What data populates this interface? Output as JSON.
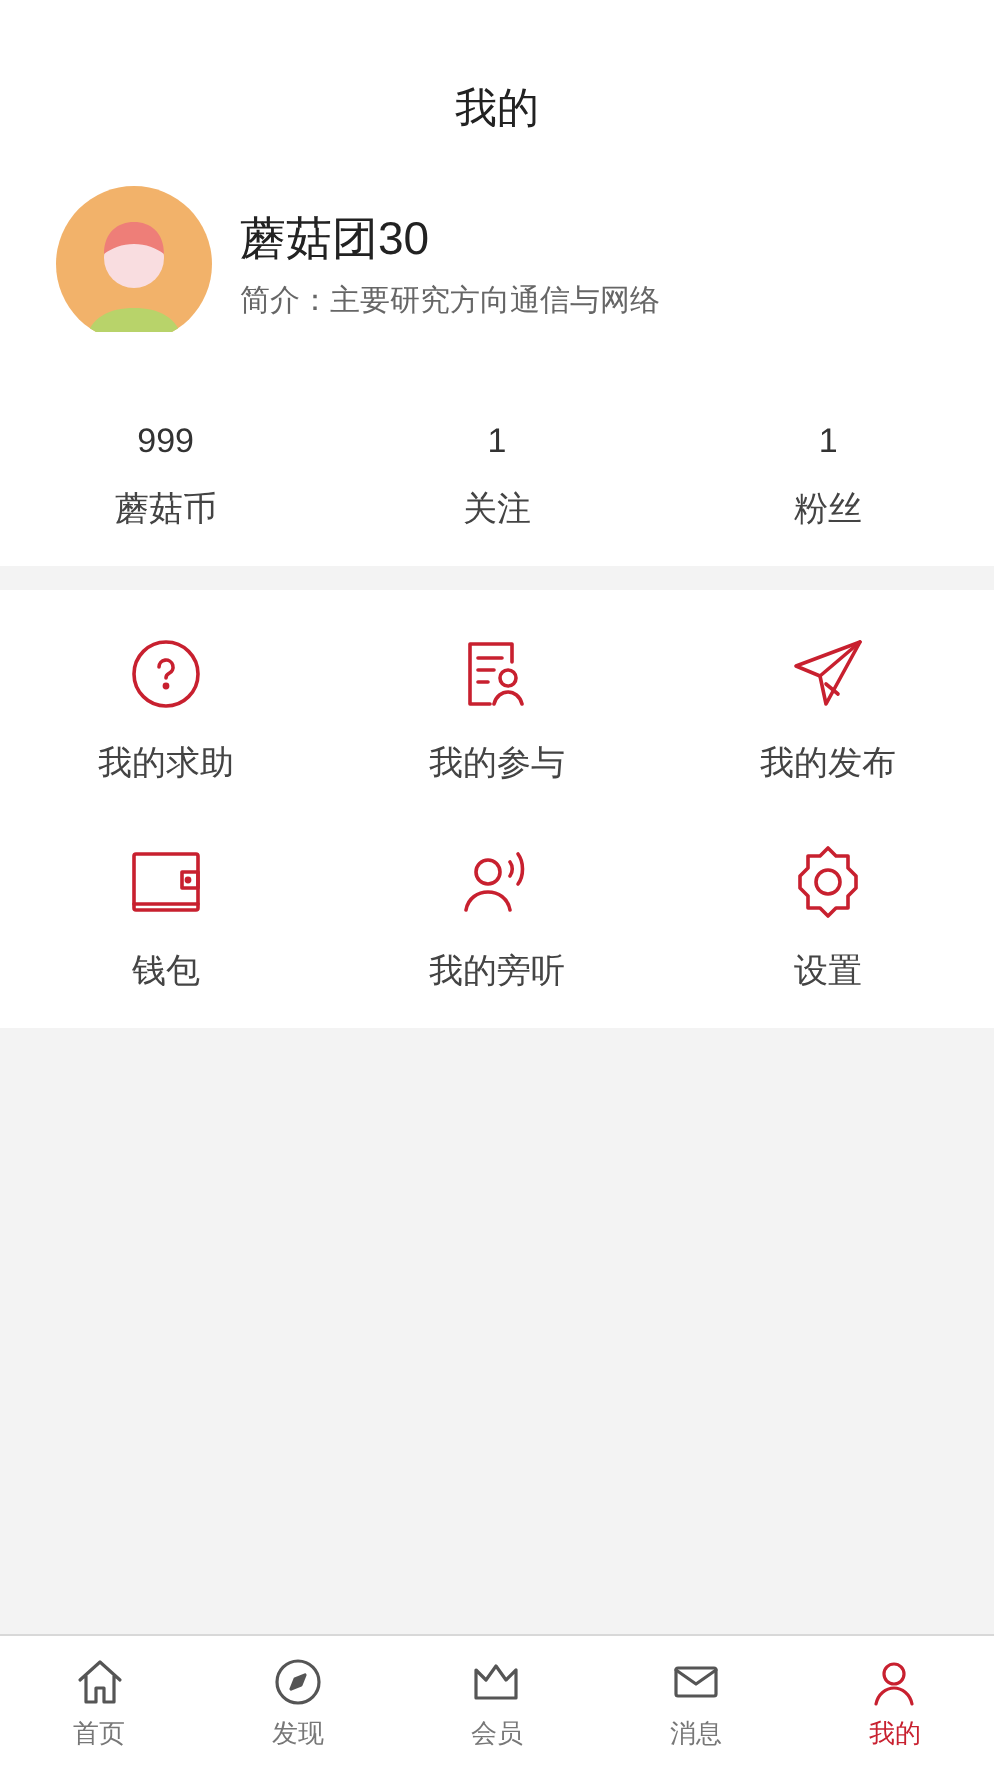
{
  "header": {
    "title": "我的"
  },
  "profile": {
    "name": "蘑菇团30",
    "bio": "简介：主要研究方向通信与网络"
  },
  "stats": [
    {
      "value": "999",
      "label": "蘑菇币"
    },
    {
      "value": "1",
      "label": "关注"
    },
    {
      "value": "1",
      "label": "粉丝"
    }
  ],
  "menu": [
    {
      "kind": "help",
      "label": "我的求助"
    },
    {
      "kind": "participation",
      "label": "我的参与"
    },
    {
      "kind": "publish",
      "label": "我的发布"
    },
    {
      "kind": "wallet",
      "label": "钱包"
    },
    {
      "kind": "audit",
      "label": "我的旁听"
    },
    {
      "kind": "settings",
      "label": "设置"
    }
  ],
  "tab_bar": [
    {
      "kind": "home",
      "label": "首页",
      "selected": false
    },
    {
      "kind": "discover",
      "label": "发现",
      "selected": false
    },
    {
      "kind": "member",
      "label": "会员",
      "selected": false
    },
    {
      "kind": "messages",
      "label": "消息",
      "selected": false
    },
    {
      "kind": "me",
      "label": "我的",
      "selected": true
    }
  ]
}
